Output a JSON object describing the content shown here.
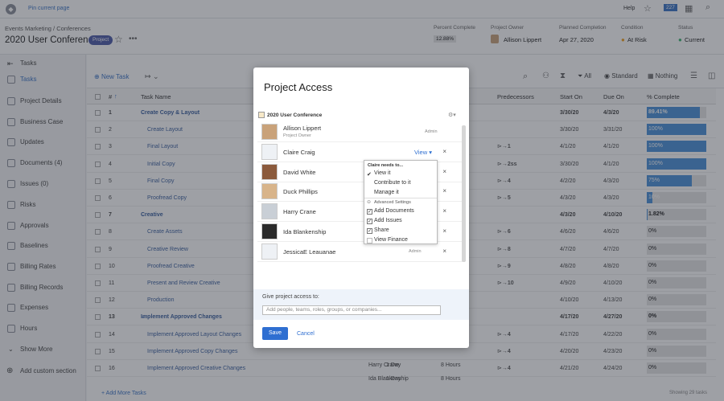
{
  "topbar": {
    "pin_label": "Pin current page",
    "help": "Help",
    "notif_count": "227"
  },
  "header": {
    "breadcrumb": "Events Marketing  /  Conferences",
    "title": "2020 User Conference",
    "badge": "Project",
    "fields": [
      {
        "label": "Percent Complete",
        "value": "12.88%"
      },
      {
        "label": "Project Owner",
        "value": "Allison Lippert"
      },
      {
        "label": "Planned Completion",
        "value": "Apr 27, 2020"
      },
      {
        "label": "Condition",
        "value": "At Risk"
      },
      {
        "label": "Status",
        "value": "Current"
      }
    ]
  },
  "sidebar": {
    "back": "Tasks",
    "items": [
      "Tasks",
      "Project Details",
      "Business Case",
      "Updates",
      "Documents (4)",
      "Issues (0)",
      "Risks",
      "Approvals",
      "Baselines",
      "Billing Rates",
      "Billing Records",
      "Expenses",
      "Hours",
      "Show More",
      "Add custom section"
    ]
  },
  "toolbar": {
    "new_task": "New Task",
    "filter": "All",
    "view": "Standard",
    "group": "Nothing"
  },
  "columns": [
    "#",
    "Task Name",
    "Predecessors",
    "Start On",
    "Due On",
    "% Complete"
  ],
  "rows": [
    {
      "num": "1",
      "name": "Create Copy & Layout",
      "bold": true,
      "pred": "",
      "start": "3/30/20",
      "due": "4/3/20",
      "pct": "89.41%",
      "frac": 0.894
    },
    {
      "num": "2",
      "name": "Create Layout",
      "bold": false,
      "pred": "",
      "start": "3/30/20",
      "due": "3/31/20",
      "pct": "100%",
      "frac": 1.0
    },
    {
      "num": "3",
      "name": "Final Layout",
      "bold": false,
      "pred": "1",
      "start": "4/1/20",
      "due": "4/1/20",
      "pct": "100%",
      "frac": 1.0
    },
    {
      "num": "4",
      "name": "Initial Copy",
      "bold": false,
      "pred": "2ss",
      "start": "3/30/20",
      "due": "4/1/20",
      "pct": "100%",
      "frac": 1.0
    },
    {
      "num": "5",
      "name": "Final Copy",
      "bold": false,
      "pred": "4",
      "start": "4/2/20",
      "due": "4/3/20",
      "pct": "75%",
      "frac": 0.75
    },
    {
      "num": "6",
      "name": "Proofread Copy",
      "bold": false,
      "pred": "5",
      "start": "4/3/20",
      "due": "4/3/20",
      "pct": "10%",
      "frac": 0.1
    },
    {
      "num": "7",
      "name": "Creative",
      "bold": true,
      "pred": "",
      "start": "4/3/20",
      "due": "4/10/20",
      "pct": "1.82%",
      "frac": 0.018
    },
    {
      "num": "8",
      "name": "Create Assets",
      "bold": false,
      "pred": "6",
      "start": "4/6/20",
      "due": "4/6/20",
      "pct": "0%",
      "frac": 0
    },
    {
      "num": "9",
      "name": "Creative Review",
      "bold": false,
      "pred": "8",
      "start": "4/7/20",
      "due": "4/7/20",
      "pct": "0%",
      "frac": 0
    },
    {
      "num": "10",
      "name": "Proofread Creative",
      "bold": false,
      "pred": "9",
      "start": "4/8/20",
      "due": "4/8/20",
      "pct": "0%",
      "frac": 0
    },
    {
      "num": "11",
      "name": "Present and Review Creative",
      "bold": false,
      "pred": "10",
      "start": "4/9/20",
      "due": "4/10/20",
      "pct": "0%",
      "frac": 0
    },
    {
      "num": "12",
      "name": "Production",
      "bold": false,
      "pred": "",
      "start": "4/10/20",
      "due": "4/13/20",
      "pct": "0%",
      "frac": 0
    },
    {
      "num": "13",
      "name": "Implement Approved Changes",
      "bold": true,
      "pred": "",
      "start": "4/17/20",
      "due": "4/27/20",
      "pct": "0%",
      "frac": 0
    },
    {
      "num": "14",
      "name": "Implement Approved Layout Changes",
      "bold": false,
      "pred": "4",
      "start": "4/17/20",
      "due": "4/22/20",
      "pct": "0%",
      "frac": 0
    },
    {
      "num": "15",
      "name": "Implement Approved Copy Changes",
      "bold": false,
      "pred": "4",
      "start": "4/20/20",
      "due": "4/23/20",
      "pct": "0%",
      "frac": 0
    },
    {
      "num": "16",
      "name": "Implement Approved Creative Changes",
      "bold": false,
      "pred": "4",
      "start": "4/21/20",
      "due": "4/24/20",
      "pct": "0%",
      "frac": 0
    }
  ],
  "extra": {
    "r15_owner": "Harry Crane",
    "r16_owner": "Ida Blankenship",
    "duration": "1 Day",
    "hours": "8 Hours",
    "add_more": "Add More Tasks",
    "showing": "Showing 29 tasks"
  },
  "modal": {
    "title": "Project Access",
    "project": "2020 User Conference",
    "users": [
      {
        "name": "Allison Lippert",
        "sub": "Project Owner",
        "role": "Admin"
      },
      {
        "name": "Claire Craig",
        "sub": "",
        "role": "View"
      },
      {
        "name": "David White",
        "sub": "",
        "role": ""
      },
      {
        "name": "Duck Phillips",
        "sub": "",
        "role": ""
      },
      {
        "name": "Harry Crane",
        "sub": "",
        "role": ""
      },
      {
        "name": "Ida Blankenship",
        "sub": "",
        "role": ""
      },
      {
        "name": "JessicaE Leauanae",
        "sub": "",
        "role": "Admin"
      }
    ],
    "dropdown": {
      "heading": "Claire needs to...",
      "options": [
        "View it",
        "Contribute to it",
        "Manage it"
      ],
      "advanced": "Advanced Settings",
      "checks": [
        {
          "label": "Add Documents",
          "checked": true
        },
        {
          "label": "Add Issues",
          "checked": true
        },
        {
          "label": "Share",
          "checked": true
        },
        {
          "label": "View Finance",
          "checked": false
        }
      ]
    },
    "give_label": "Give project access to:",
    "give_placeholder": "Add people, teams, roles, groups, or companies...",
    "save": "Save",
    "cancel": "Cancel"
  },
  "colors": {
    "accent": "#2f6fd1",
    "bar": "#4a90d9",
    "badge": "#4c5aa8",
    "at_risk": "#f0a020",
    "current": "#3cb371"
  }
}
